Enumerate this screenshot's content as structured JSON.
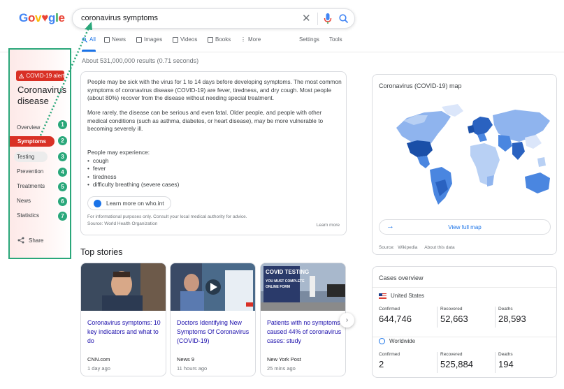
{
  "search": {
    "query": "coronavirus symptoms"
  },
  "logo": {
    "text": "Google"
  },
  "tabs": [
    "All",
    "News",
    "Images",
    "Videos",
    "Books",
    "More",
    "Settings",
    "Tools"
  ],
  "results_count": "About 531,000,000 results (0.71 seconds)",
  "covid_panel": {
    "alert": "COVID-19 alert",
    "title": "Coronavirus disease",
    "nav": [
      "Overview",
      "Symptoms",
      "Testing",
      "Prevention",
      "Treatments",
      "News",
      "Statistics"
    ],
    "badges": [
      "1",
      "2",
      "3",
      "4",
      "5",
      "6",
      "7"
    ],
    "share": "Share"
  },
  "info": {
    "para1": "People may be sick with the virus for 1 to 14 days before developing symptoms. The most common symptoms of coronavirus disease (COVID-19) are fever, tiredness, and dry cough. Most people (about 80%) recover from the disease without needing special treatment.",
    "para2": "More rarely, the disease can be serious and even fatal. Older people, and people with other medical conditions (such as asthma, diabetes, or heart disease), may be more vulnerable to becoming severely ill.",
    "experience_label": "People may experience:",
    "symptoms": [
      "cough",
      "fever",
      "tiredness",
      "difficulty breathing (severe cases)"
    ],
    "learn_button": "Learn more on who.int",
    "disclaimer": "For informational purposes only. Consult your local medical authority for advice.",
    "source": "Source: World Health Organization",
    "learn_more": "Learn more"
  },
  "top_stories": {
    "heading": "Top stories",
    "stories": [
      {
        "headline": "Coronavirus symptoms: 10 key indicators and what to do",
        "source": "CNN.com",
        "time": "1 day ago"
      },
      {
        "headline": "Doctors Identifying New Symptoms Of Coronavirus (COVID-19)",
        "source": "News 9",
        "time": "11 hours ago"
      },
      {
        "headline": "Patients with no symptoms caused 44% of coronavirus cases: study",
        "source": "New York Post",
        "time": "25 mins ago",
        "image_text": "COVID TESTING YOU MUST COMPLETE ONLINE FORM"
      }
    ]
  },
  "map_panel": {
    "title": "Coronavirus (COVID-19) map",
    "view_full_map": "View full map",
    "source_label": "Source:",
    "source_link": "Wikipedia",
    "about": "About this data"
  },
  "cases": {
    "title": "Cases overview",
    "regions": [
      {
        "name": "United States",
        "confirmed_label": "Confirmed",
        "confirmed": "644,746",
        "recovered_label": "Recovered",
        "recovered": "52,663",
        "deaths_label": "Deaths",
        "deaths": "28,593"
      },
      {
        "name": "Worldwide",
        "confirmed_label": "Confirmed",
        "confirmed": "2",
        "recovered_label": "Recovered",
        "recovered": "525,884",
        "deaths_label": "Deaths",
        "deaths": "194"
      }
    ]
  },
  "colors": {
    "alert_red": "#d93025",
    "annotation_green": "#2aa77a",
    "link_blue": "#1a0dab",
    "accent_blue": "#1a73e8"
  }
}
